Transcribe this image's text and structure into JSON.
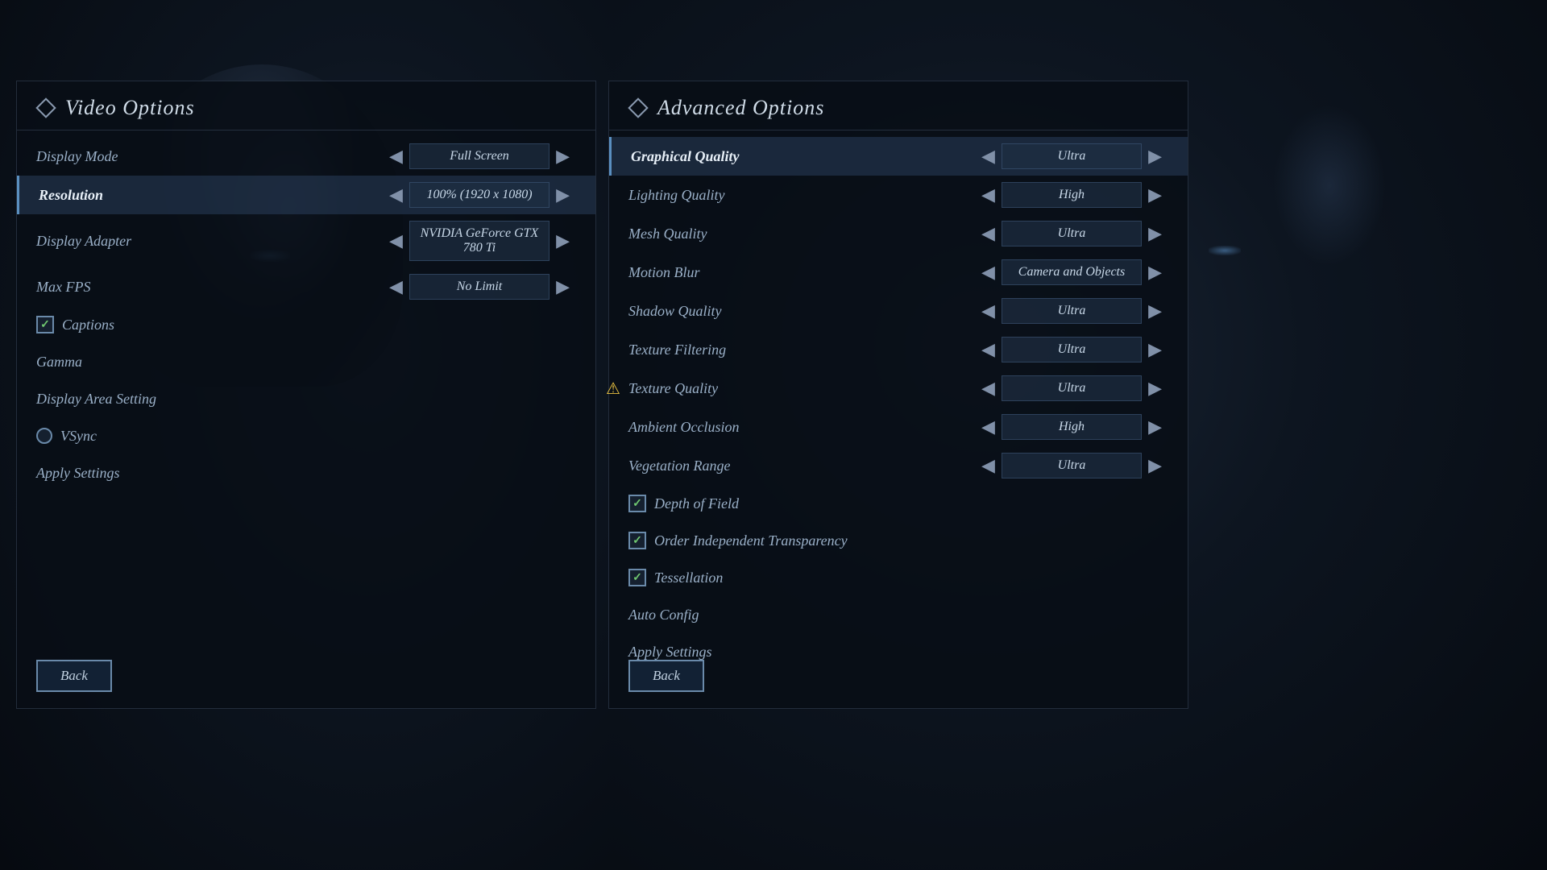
{
  "leftPanel": {
    "title": "Video Options",
    "settings": [
      {
        "id": "display-mode",
        "label": "Display Mode",
        "type": "selector",
        "value": "Full Screen",
        "selected": false
      },
      {
        "id": "resolution",
        "label": "Resolution",
        "type": "selector",
        "value": "100% (1920 x 1080)",
        "selected": true
      },
      {
        "id": "display-adapter",
        "label": "Display Adapter",
        "type": "selector",
        "value": "NVIDIA GeForce GTX 780 Ti",
        "selected": false
      },
      {
        "id": "max-fps",
        "label": "Max FPS",
        "type": "selector",
        "value": "No Limit",
        "selected": false
      },
      {
        "id": "captions",
        "label": "Captions",
        "type": "checkbox",
        "checked": true,
        "selected": false
      },
      {
        "id": "gamma",
        "label": "Gamma",
        "type": "plain",
        "selected": false
      },
      {
        "id": "display-area",
        "label": "Display Area Setting",
        "type": "plain",
        "selected": false
      },
      {
        "id": "vsync",
        "label": "VSync",
        "type": "radio",
        "checked": false,
        "selected": false
      },
      {
        "id": "apply-left",
        "label": "Apply Settings",
        "type": "plain",
        "selected": false
      }
    ],
    "backBtn": "Back"
  },
  "rightPanel": {
    "title": "Advanced Options",
    "settings": [
      {
        "id": "graphical-quality",
        "label": "Graphical Quality",
        "type": "selector",
        "value": "Ultra",
        "selected": true,
        "warning": false
      },
      {
        "id": "lighting-quality",
        "label": "Lighting Quality",
        "type": "selector",
        "value": "High",
        "selected": false,
        "warning": false
      },
      {
        "id": "mesh-quality",
        "label": "Mesh Quality",
        "type": "selector",
        "value": "Ultra",
        "selected": false,
        "warning": false
      },
      {
        "id": "motion-blur",
        "label": "Motion Blur",
        "type": "selector",
        "value": "Camera and Objects",
        "selected": false,
        "warning": false
      },
      {
        "id": "shadow-quality",
        "label": "Shadow Quality",
        "type": "selector",
        "value": "Ultra",
        "selected": false,
        "warning": false
      },
      {
        "id": "texture-filtering",
        "label": "Texture Filtering",
        "type": "selector",
        "value": "Ultra",
        "selected": false,
        "warning": false
      },
      {
        "id": "texture-quality",
        "label": "Texture Quality",
        "type": "selector",
        "value": "Ultra",
        "selected": false,
        "warning": true
      },
      {
        "id": "ambient-occlusion",
        "label": "Ambient Occlusion",
        "type": "selector",
        "value": "High",
        "selected": false,
        "warning": false
      },
      {
        "id": "vegetation-range",
        "label": "Vegetation Range",
        "type": "selector",
        "value": "Ultra",
        "selected": false,
        "warning": false
      },
      {
        "id": "depth-of-field",
        "label": "Depth of Field",
        "type": "checkbox",
        "checked": true,
        "selected": false
      },
      {
        "id": "order-transparency",
        "label": "Order Independent Transparency",
        "type": "checkbox",
        "checked": true,
        "selected": false
      },
      {
        "id": "tessellation",
        "label": "Tessellation",
        "type": "checkbox",
        "checked": true,
        "selected": false
      },
      {
        "id": "auto-config",
        "label": "Auto Config",
        "type": "plain",
        "selected": false
      },
      {
        "id": "apply-right",
        "label": "Apply Settings",
        "type": "plain",
        "selected": false
      }
    ],
    "backBtn": "Back"
  },
  "arrows": {
    "left": "◀",
    "right": "▶"
  }
}
